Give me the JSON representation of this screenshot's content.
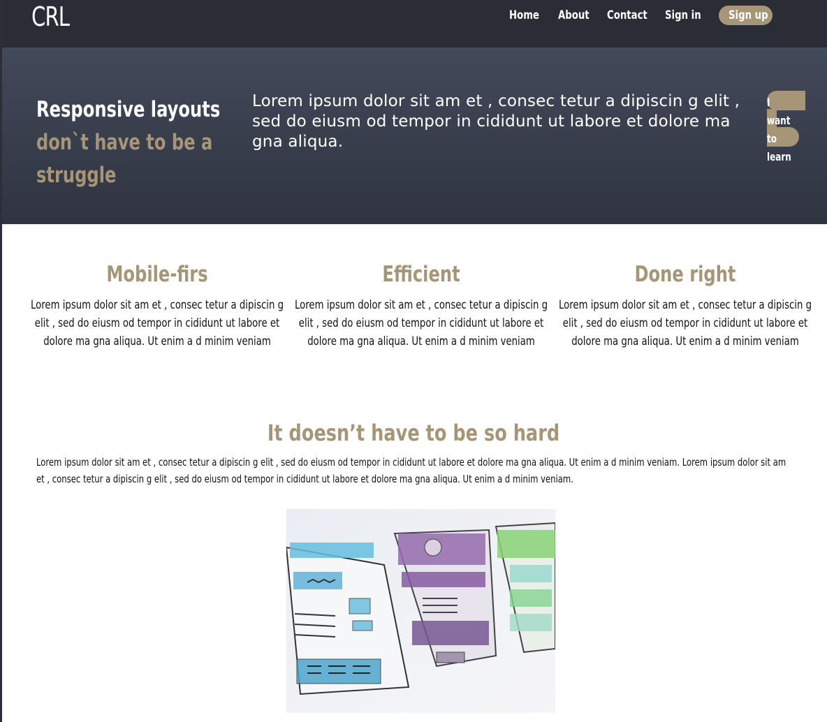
{
  "header": {
    "logo": "CRL",
    "nav": [
      {
        "label": "Home"
      },
      {
        "label": "About"
      },
      {
        "label": "Contact"
      },
      {
        "label": "Sign in"
      }
    ],
    "signup_label": "Sign up"
  },
  "hero": {
    "title_line1": "Responsive layouts",
    "title_line2": "don`t have to be a",
    "title_line3": "struggle",
    "text": "Lorem ipsum dolor sit am et , consec tetur a dipiscin g elit , sed do eiusm od tempor in cididunt ut labore et dolore ma gna aliqua.",
    "cta_label": "I want to learn"
  },
  "features": [
    {
      "title": "Mobile-firs",
      "text": "Lorem ipsum dolor sit am et , consec tetur a dipiscin g elit , sed do eiusm od tempor in cididunt ut labore et dolore ma gna aliqua. Ut enim a d minim veniam"
    },
    {
      "title": "Efficient",
      "text": "Lorem ipsum dolor sit am et , consec tetur a dipiscin g elit , sed do eiusm od tempor in cididunt ut labore et dolore ma gna aliqua. Ut enim a d minim veniam"
    },
    {
      "title": "Done right",
      "text": "Lorem ipsum dolor sit am et , consec tetur a dipiscin g elit , sed do eiusm od tempor in cididunt ut labore et dolore ma gna aliqua. Ut enim a d minim veniam"
    }
  ],
  "section": {
    "title": "It doesn’t have to be so hard",
    "text": "Lorem ipsum dolor sit am et , consec tetur a dipiscin g elit , sed do eiusm od tempor in cididunt ut labore et dolore ma gna aliqua. Ut enim a d minim veniam. Lorem ipsum dolor sit am et , consec tetur a dipiscin g elit , sed do eiusm od tempor in cididunt ut labore et dolore ma gna aliqua. Ut enim a d minim veniam."
  },
  "colors": {
    "header_bg": "#2a2d36",
    "hero_bg": "#3a3f4d",
    "accent_tan": "#a69577",
    "text": "#111111"
  },
  "image": {
    "icon": "wireframe-sketch-image"
  }
}
